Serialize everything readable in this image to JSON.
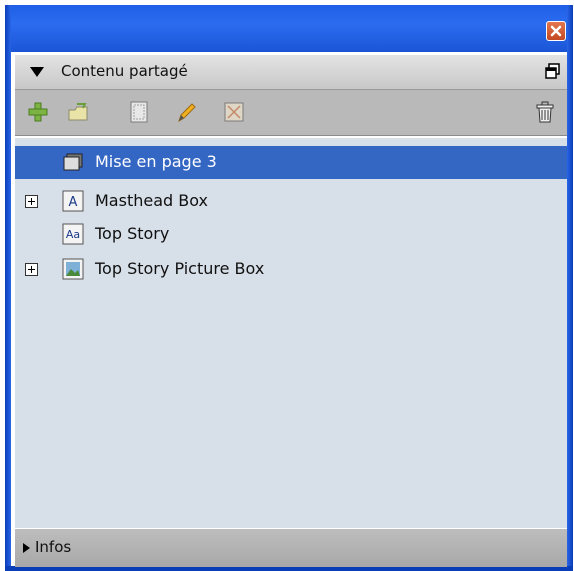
{
  "window": {
    "close_icon": "close-icon"
  },
  "panel": {
    "title": "Contenu partagé",
    "collapse_icon": "triangle-down-icon",
    "float_icon": "float-window-icon"
  },
  "toolbar": {
    "buttons": [
      "add-icon",
      "folder-icon",
      "text-box-icon",
      "pencil-icon",
      "picture-box-icon"
    ],
    "trash_icon": "trash-icon"
  },
  "tree": {
    "items": [
      {
        "label": "Mise en page 3",
        "icon": "layout-icon",
        "selected": true,
        "expandable": false
      },
      {
        "label": "Masthead Box",
        "icon": "text-a-icon",
        "selected": false,
        "expandable": true
      },
      {
        "label": "Top Story",
        "icon": "text-aa-icon",
        "selected": false,
        "expandable": false
      },
      {
        "label": "Top Story Picture Box",
        "icon": "picture-icon",
        "selected": false,
        "expandable": true
      }
    ]
  },
  "footer": {
    "label": "Infos",
    "expand_icon": "triangle-right-icon"
  },
  "colors": {
    "titlebar": "#1e5fe6",
    "selection": "#3466c4",
    "list_bg": "#d7dfe8",
    "close": "#d5582e"
  }
}
